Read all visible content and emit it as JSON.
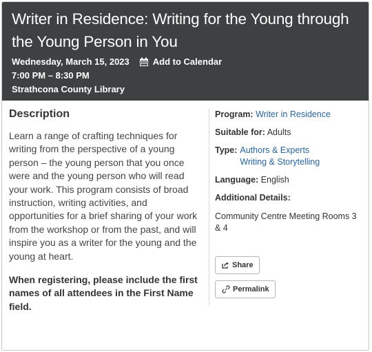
{
  "event": {
    "title": "Writer in Residence: Writing for the Young through the Young Person in You",
    "date": "Wednesday, March 15, 2023",
    "add_to_calendar": "Add to Calendar",
    "time": "7:00 PM – 8:30 PM",
    "location": "Strathcona County Library"
  },
  "description": {
    "heading": "Description",
    "body": "Learn a range of crafting techniques for writing from the perspective of a young person – the young person that you once were and the young person who will read your work. This program consists of broad instruction, writing activities, and opportunities for a brief sharing of your work from the workshop or from the past, and will inspire you as a writer for the young and the young at heart.",
    "note": "When registering, please include the first names of all attendees in the First Name field."
  },
  "details": {
    "program_label": "Program:",
    "program_value": "Writer in Residence",
    "suitable_label": "Suitable for:",
    "suitable_value": "Adults",
    "type_label": "Type:",
    "type_values": [
      "Authors & Experts",
      "Writing & Storytelling"
    ],
    "language_label": "Language:",
    "language_value": "English",
    "additional_label": "Additional Details:",
    "additional_value": "Community Centre Meeting Rooms 3 & 4"
  },
  "actions": {
    "share_label": "Share",
    "permalink_label": "Permalink"
  },
  "icons": {
    "calendar": "calendar-icon",
    "share": "share-icon",
    "permalink": "link-icon"
  },
  "colors": {
    "header_bg": "#3d4142",
    "link": "#2a6496"
  }
}
